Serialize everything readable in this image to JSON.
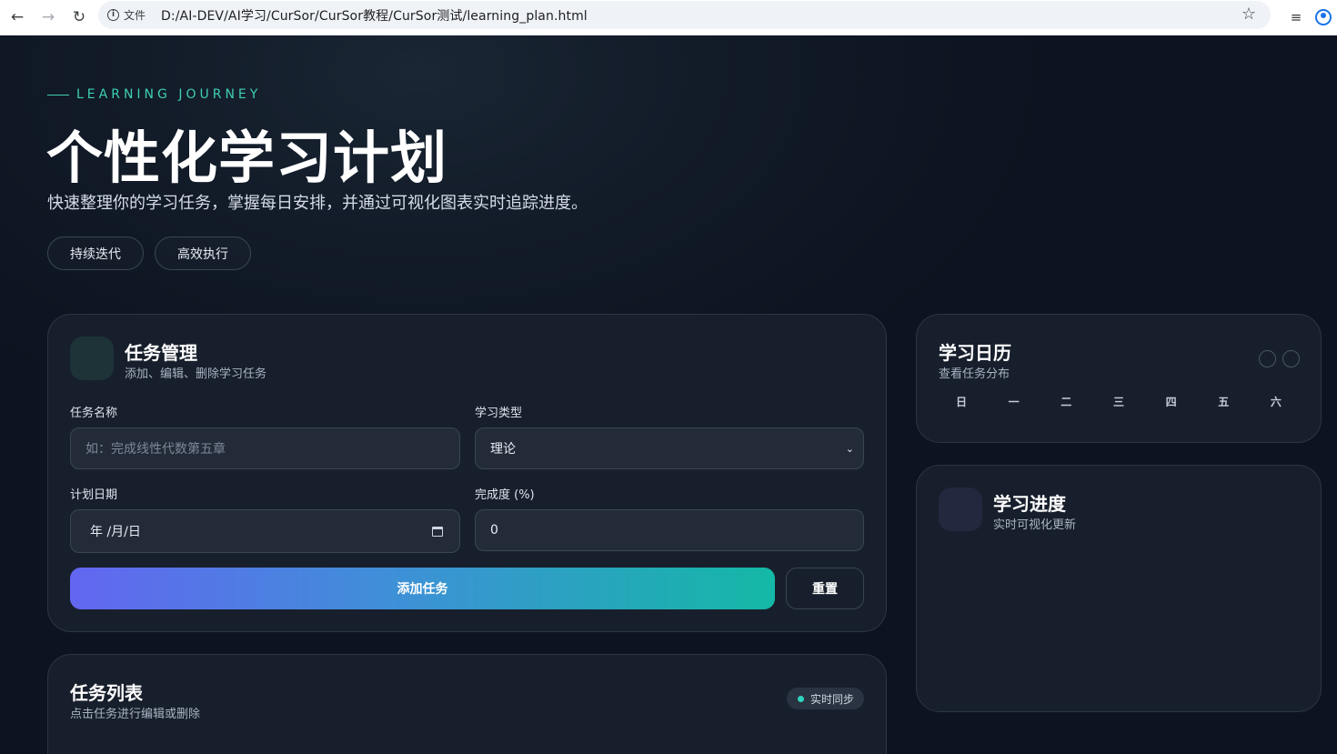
{
  "browser": {
    "info_label": "文件",
    "url": "D:/AI-DEV/AI学习/CurSor/CurSor教程/CurSor测试/learning_plan.html"
  },
  "hero": {
    "eyebrow": "LEARNING JOURNEY",
    "title": "个性化学习计划",
    "subtitle": "快速整理你的学习任务，掌握每日安排，并通过可视化图表实时追踪进度。",
    "pills": [
      "持续迭代",
      "高效执行"
    ]
  },
  "task_manager": {
    "title": "任务管理",
    "subtitle": "添加、编辑、删除学习任务",
    "name_label": "任务名称",
    "name_placeholder": "如：完成线性代数第五章",
    "type_label": "学习类型",
    "type_value": "理论",
    "date_label": "计划日期",
    "date_value": "年 /月/日",
    "progress_label": "完成度 (%)",
    "progress_value": "0",
    "add_button": "添加任务",
    "reset_button": "重置"
  },
  "task_list": {
    "title": "任务列表",
    "subtitle": "点击任务进行编辑或删除",
    "badge": "实时同步"
  },
  "calendar": {
    "title": "学习日历",
    "subtitle": "查看任务分布",
    "weekdays": [
      "日",
      "一",
      "二",
      "三",
      "四",
      "五",
      "六"
    ]
  },
  "progress": {
    "title": "学习进度",
    "subtitle": "实时可视化更新"
  },
  "colors": {
    "accent_teal": "#3ed0b3",
    "gradient_start": "#6366f1",
    "gradient_end": "#14b8a6",
    "card_bg": "#181f2c",
    "page_bg": "#0d1320"
  }
}
